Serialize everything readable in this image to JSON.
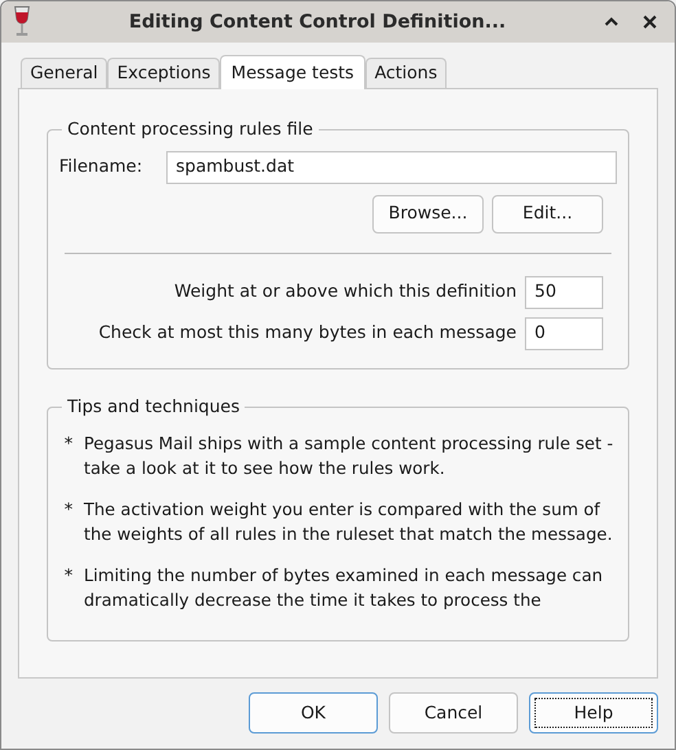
{
  "window": {
    "title": "Editing Content Control Definition..."
  },
  "tabs": [
    {
      "label": "General",
      "selected": false
    },
    {
      "label": "Exceptions",
      "selected": false
    },
    {
      "label": "Message tests",
      "selected": true
    },
    {
      "label": "Actions",
      "selected": false
    }
  ],
  "rules_group": {
    "title": "Content processing rules file",
    "filename_label": "Filename:",
    "filename": "spambust.dat",
    "buttons": [
      "Browse...",
      "Edit..."
    ],
    "fields": [
      {
        "label": "Weight at or above which this definition",
        "value": "50"
      },
      {
        "label": "Check at most this many bytes in each message",
        "value": "0"
      }
    ]
  },
  "tips_group": {
    "title": "Tips and techniques",
    "tips": [
      {
        "bullet": "*",
        "lines": [
          "Pegasus Mail ships with a sample content processing rule set -",
          "take a look at it to see how the rules work."
        ]
      },
      {
        "bullet": "*",
        "lines": [
          "The activation weight you enter is compared with the sum of",
          "the weights of all rules in the ruleset that match the message."
        ]
      },
      {
        "bullet": "*",
        "lines": [
          "Limiting the number of bytes examined in each message can",
          "dramatically decrease the time it takes to process the"
        ]
      }
    ]
  },
  "buttons": [
    {
      "label": "OK",
      "default": true,
      "focused": false
    },
    {
      "label": "Cancel",
      "default": false,
      "focused": false
    },
    {
      "label": "Help",
      "default": false,
      "focused": true
    }
  ]
}
